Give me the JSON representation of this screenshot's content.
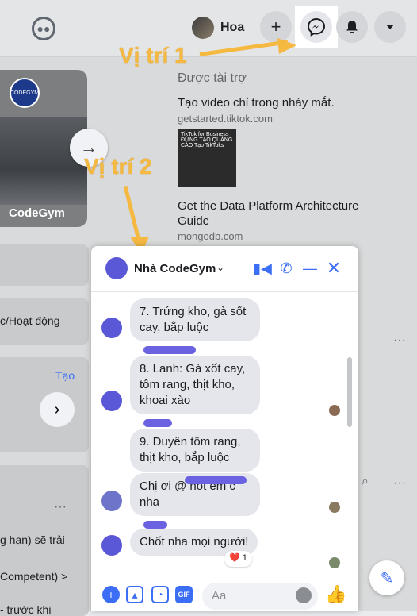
{
  "topbar": {
    "profile_name": "Hoa",
    "plus_label": "+",
    "groups_icon": "groups-icon",
    "messenger_icon": "messenger-icon",
    "bell_icon": "bell-icon",
    "menu_icon": "chevron-down-icon"
  },
  "annotations": {
    "position1": "Vị trí 1",
    "position2": "Vị trí 2",
    "accent_color": "#f5b942"
  },
  "stories": {
    "card_name": "CodeGym",
    "logo_text": "CODEGYM"
  },
  "sponsored": {
    "heading": "Được tài trợ",
    "ads": [
      {
        "title": "Tạo video chỉ trong nháy mắt.",
        "url": "getstarted.tiktok.com",
        "image_text": "TikTok for Business ĐỪNG TẠO QUẢNG CÁO Tạo TikToks"
      },
      {
        "title": "Get the Data Platform Architecture Guide",
        "url": "mongodb.com"
      }
    ]
  },
  "left": {
    "activity": "c/Hoạt động",
    "create": "Tạo",
    "line1": "g hạn) sẽ trải",
    "line2": "Competent) >",
    "line3": "- trước khi"
  },
  "chat": {
    "title": "Nhà CodeGym",
    "accent": "#3c6ef5",
    "messages": [
      {
        "text": "7. Trứng kho, gà sốt cay, bắp luộc"
      },
      {
        "text": "8. Lanh: Gà xốt cay, tôm rang, thịt kho, khoai xào"
      },
      {
        "text": "9. Duyên tôm rang, thịt kho, bắp luộc"
      },
      {
        "text": "Chị ơi @ nốt em c nha"
      },
      {
        "text": "Chốt nha mọi người!"
      }
    ],
    "reaction": "❤️ 1",
    "input_placeholder": "Aa"
  }
}
